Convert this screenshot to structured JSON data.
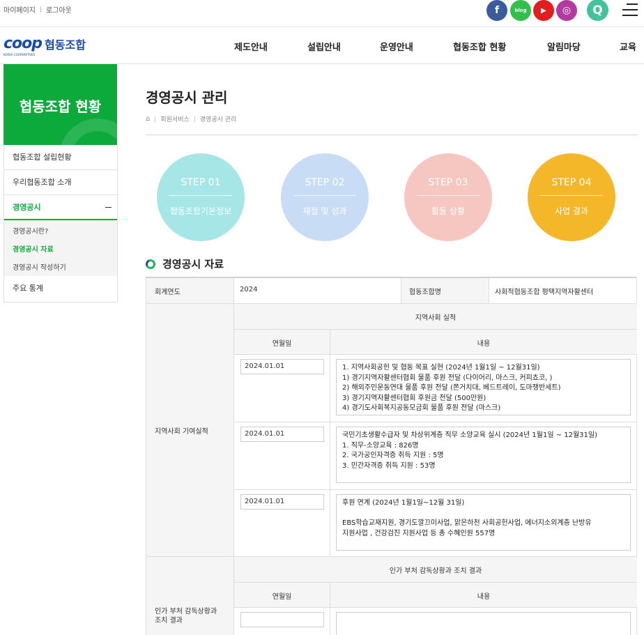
{
  "topbar": {
    "mypage": "마이페이지",
    "logout": "로그아웃",
    "social": [
      {
        "name": "facebook-icon",
        "glyph": "f",
        "color": "#3b5b9a"
      },
      {
        "name": "blog-icon",
        "glyph": "blog",
        "color": "#2fc14b"
      },
      {
        "name": "youtube-icon",
        "glyph": "▶",
        "color": "#e21d1d"
      },
      {
        "name": "instagram-icon",
        "glyph": "◎",
        "color": "#b33aa0"
      },
      {
        "name": "search-icon",
        "glyph": "Q",
        "color": "#43c29b"
      }
    ]
  },
  "header": {
    "logo_mark": "coop",
    "logo_sub": "KOREA COOPERATIVES",
    "logo_text": "협동조합",
    "nav": [
      "제도안내",
      "설립안내",
      "운영안내",
      "협동조합 현황",
      "알림마당",
      "교육"
    ]
  },
  "sidebar": {
    "title": "협동조합 현황",
    "items": [
      "협동조합 설립현황",
      "우리협동조합 소개",
      "경영공시",
      "주요 통계"
    ],
    "sub_items": [
      "경영공시란?",
      "경영공시 자료",
      "경영공시 작성하기"
    ]
  },
  "page": {
    "title": "경영공시 관리",
    "breadcrumb": [
      "회원서비스",
      "경영공시 관리"
    ]
  },
  "steps": [
    {
      "num": "STEP 01",
      "label": "협동조합기본정보",
      "color": "#a6e6e6"
    },
    {
      "num": "STEP 02",
      "label": "재정 및 성과",
      "color": "#c9dcf6"
    },
    {
      "num": "STEP 03",
      "label": "활동 상황",
      "color": "#f6c7c0"
    },
    {
      "num": "STEP 04",
      "label": "사업 결과",
      "color": "#f4b72a"
    }
  ],
  "section": {
    "title": "경영공시 자료"
  },
  "table": {
    "year_label": "회계연도",
    "year_value": "2024",
    "coop_label": "협동조합명",
    "coop_value": "사회적협동조합 평택지역자활센터",
    "community": {
      "row_label": "지역사회 기여실적",
      "group_title": "지역사회 실적",
      "col_date": "연월일",
      "col_content": "내용",
      "entries": [
        {
          "date": "2024.01.01",
          "lines": [
            "1. 지역사회공헌 및 협동 목표 실현 (2024년 1월1일 ~ 12월31일)",
            "1) 경기지역자활센터협회 물품 후원 전달 (다이어리, 마스크, 커피쵸코, )",
            "2) 해외주민운동연대 물품 후원 전달 (쫀거치대, 베드트레이, 도마쟁반세트)",
            "3) 경기지역자활센터협회 후원금 전달 (500만원)",
            "4) 경기도사회복지공동모금회 물품 후원 전달 (마스크)"
          ]
        },
        {
          "date": "2024.01.01",
          "lines": [
            "국민기초생활수급자 및 차상위계층 직무 소양교육 실시 (2024년 1월1일 ~ 12월31일)",
            "1. 직무-소양교육 : 826명",
            "2. 국가공인자격증 취득 지원 : 5명",
            "3. 민간자격증 취득 지원 : 53명"
          ]
        },
        {
          "date": "2024.01.01",
          "lines": [
            "후원 연계 (2024년 1월1일~12월 31일)",
            "",
            "EBS학습교재지원, 경기도깔끄미사업, 맑은하천 사회공헌사업, 에너지소외계층 난방유",
            "지원사업 , 건강검진 지원사업 등 총 수혜인원 557명"
          ]
        }
      ]
    },
    "supervision": {
      "row_label_1": "인가 부처 감독상황과",
      "row_label_2": "조치 결과",
      "group_title": "인가 부처 감독상황과 조치 결과",
      "col_date": "연월일",
      "col_content": "내용",
      "date_value": "",
      "content_value": ""
    }
  }
}
